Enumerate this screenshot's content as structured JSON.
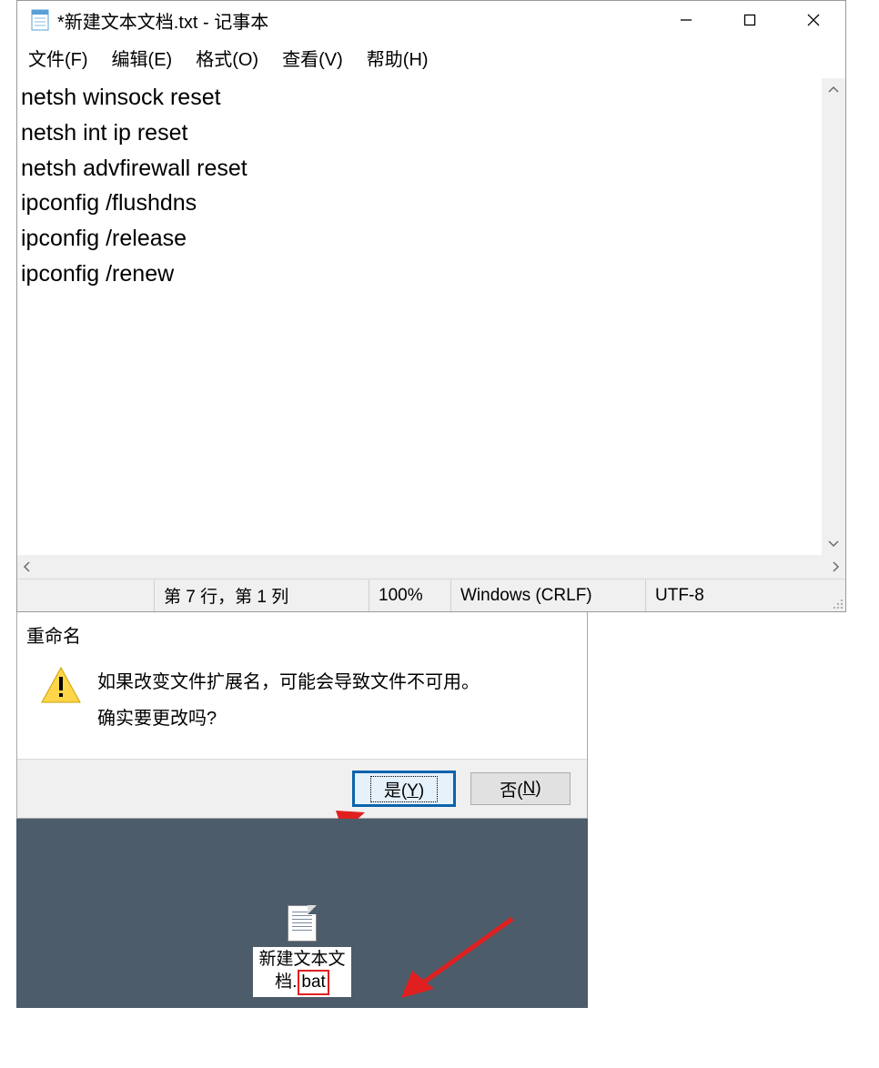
{
  "notepad": {
    "title": "*新建文本文档.txt - 记事本",
    "menus": {
      "file": "文件(F)",
      "edit": "编辑(E)",
      "format": "格式(O)",
      "view": "查看(V)",
      "help": "帮助(H)"
    },
    "content": "netsh winsock reset\nnetsh int ip reset\nnetsh advfirewall reset\nipconfig /flushdns\nipconfig /release\nipconfig /renew\n",
    "status": {
      "position": "第 7 行，第 1 列",
      "zoom": "100%",
      "eol": "Windows (CRLF)",
      "encoding": "UTF-8"
    }
  },
  "dialog": {
    "title": "重命名",
    "line1": "如果改变文件扩展名，可能会导致文件不可用。",
    "line2": "确实要更改吗?",
    "yes_prefix": "是(",
    "yes_key": "Y",
    "yes_suffix": ")",
    "no_prefix": "否(",
    "no_key": "N",
    "no_suffix": ")"
  },
  "desktop_file": {
    "name_line1": "新建文本文",
    "name_line2_prefix": "档.",
    "ext": "bat"
  }
}
